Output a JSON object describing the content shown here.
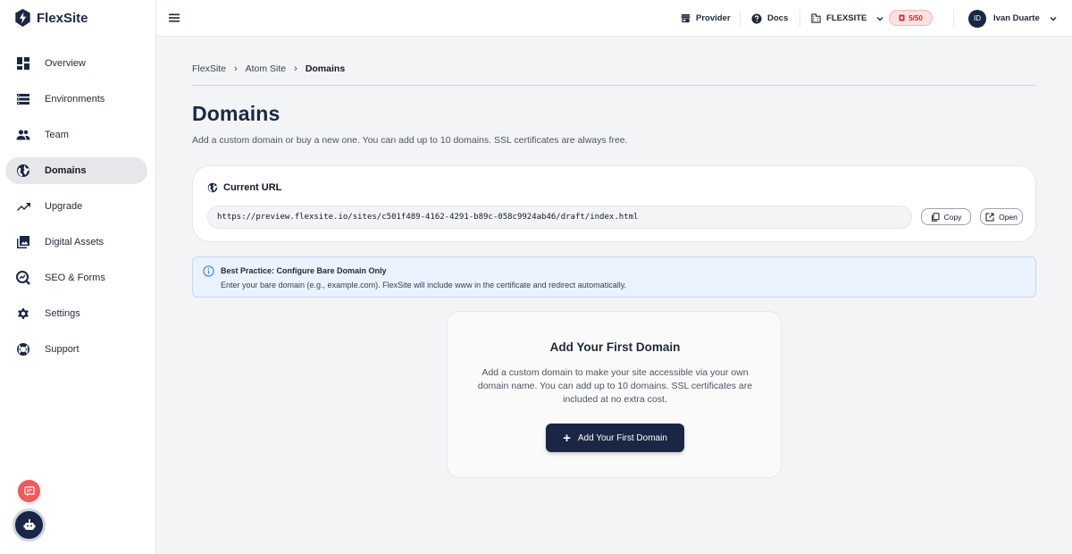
{
  "app": {
    "name": "FlexSite"
  },
  "sidebar": {
    "items": [
      {
        "label": "Overview",
        "icon": "dashboard-icon",
        "active": false
      },
      {
        "label": "Environments",
        "icon": "list-icon",
        "active": false
      },
      {
        "label": "Team",
        "icon": "people-icon",
        "active": false
      },
      {
        "label": "Domains",
        "icon": "globe-icon",
        "active": true
      },
      {
        "label": "Upgrade",
        "icon": "trending-up-icon",
        "active": false
      },
      {
        "label": "Digital Assets",
        "icon": "image-library-icon",
        "active": false
      },
      {
        "label": "SEO & Forms",
        "icon": "seo-search-icon",
        "active": false
      },
      {
        "label": "Settings",
        "icon": "gear-icon",
        "active": false
      },
      {
        "label": "Support",
        "icon": "lifebuoy-icon",
        "active": false
      }
    ]
  },
  "topbar": {
    "provider_label": "Provider",
    "docs_label": "Docs",
    "workspace_label": "FLEXSITE",
    "credits_label": "5/50",
    "user_initials": "ID",
    "user_name": "Ivan Duarte"
  },
  "breadcrumb": [
    "FlexSite",
    "Atom Site",
    "Domains"
  ],
  "page": {
    "title": "Domains",
    "subtitle": "Add a custom domain or buy a new one. You can add up to 10 domains. SSL certificates are always free."
  },
  "current_url": {
    "heading": "Current URL",
    "value": "https://preview.flexsite.io/sites/c501f489-4162-4291-b89c-058c9924ab46/draft/index.html",
    "copy_label": "Copy",
    "open_label": "Open"
  },
  "info": {
    "title": "Best Practice: Configure Bare Domain Only",
    "text": "Enter your bare domain (e.g., example.com). FlexSite will include www in the certificate and redirect automatically."
  },
  "empty_state": {
    "title": "Add Your First Domain",
    "text": "Add a custom domain to make your site accessible via your own domain name. You can add up to 10 domains. SSL certificates are included at no extra cost.",
    "button_label": "Add Your First Domain"
  },
  "colors": {
    "brand_navy": "#1a2744",
    "danger": "#ef5a5a",
    "info_bg": "#eaf2fd"
  }
}
